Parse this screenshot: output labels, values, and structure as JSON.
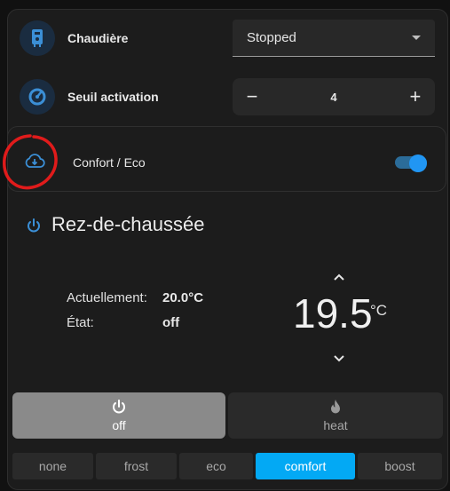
{
  "boiler": {
    "label": "Chaudière",
    "select_value": "Stopped"
  },
  "threshold": {
    "label": "Seuil activation",
    "value": "4",
    "minus": "−",
    "plus": "+"
  },
  "comfort_eco": {
    "label": "Confort / Eco",
    "enabled": true
  },
  "thermostat": {
    "name": "Rez-de-chaussée",
    "current_label": "Actuellement:",
    "current_value": "20.0°C",
    "state_label": "État:",
    "state_value": "off",
    "target": "19.5",
    "unit": "°C"
  },
  "hvac_modes": [
    {
      "label": "off",
      "icon": "power-icon",
      "active": true
    },
    {
      "label": "heat",
      "icon": "flame-icon",
      "active": false
    }
  ],
  "presets": [
    {
      "label": "none",
      "active": false
    },
    {
      "label": "frost",
      "active": false
    },
    {
      "label": "eco",
      "active": false
    },
    {
      "label": "comfort",
      "active": true
    },
    {
      "label": "boost",
      "active": false
    }
  ],
  "colors": {
    "accent": "#03a9f4",
    "icon_blue": "#3b8fd6",
    "card_bg": "#1c1c1c",
    "active_mode_bg": "#8a8a8a"
  }
}
